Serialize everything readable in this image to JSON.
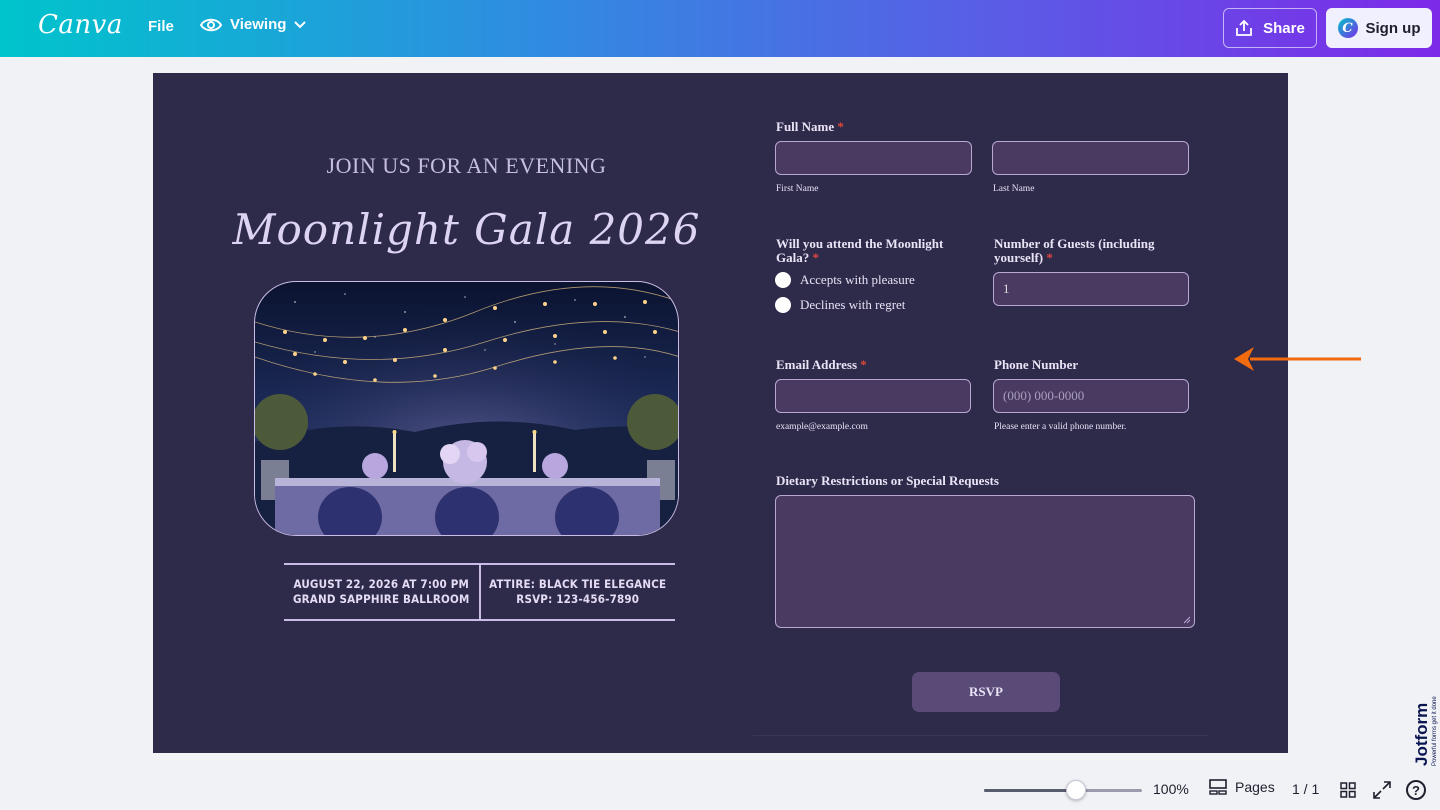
{
  "topbar": {
    "logo": "Canva",
    "file": "File",
    "viewing": "Viewing",
    "share": "Share",
    "signup": "Sign up"
  },
  "invite": {
    "heading": "JOIN US FOR AN EVENING",
    "title": "Moonlight Gala 2026",
    "date_line": "AUGUST 22, 2026 AT 7:00 PM",
    "venue_line": "GRAND SAPPHIRE BALLROOM",
    "attire_line": "ATTIRE: BLACK TIE ELEGANCE",
    "rsvp_line": "RSVP: 123-456-7890"
  },
  "form": {
    "full_name_label": "Full Name",
    "first_name_sub": "First Name",
    "last_name_sub": "Last Name",
    "attend_label": "Will you attend the Moonlight Gala?",
    "attend_options": [
      "Accepts with pleasure",
      "Declines with regret"
    ],
    "guests_label": "Number of Guests (including yourself)",
    "guests_value": "1",
    "email_label": "Email Address",
    "email_sub": "example@example.com",
    "phone_label": "Phone Number",
    "phone_placeholder": "(000) 000-0000",
    "phone_sub": "Please enter a valid phone number.",
    "dietary_label": "Dietary Restrictions or Special Requests",
    "submit": "RSVP",
    "required_mark": "*"
  },
  "badge": {
    "brand": "Jotform",
    "tagline": "Powerful forms get it done"
  },
  "bottombar": {
    "zoom": "100%",
    "zoom_level": 0.58,
    "pages": "Pages",
    "page_count": "1 / 1",
    "help": "?"
  },
  "colors": {
    "canvas_bg": "#2e2a4a",
    "input_bg": "#4a3a62",
    "accent_arrow": "#f26b0f",
    "required": "#e0483d"
  },
  "icons": [
    "eye-icon",
    "chevron-down-icon",
    "share-icon",
    "canva-c-icon",
    "pages-icon",
    "grid-icon",
    "expand-icon",
    "help-icon",
    "arrow-left-icon"
  ]
}
